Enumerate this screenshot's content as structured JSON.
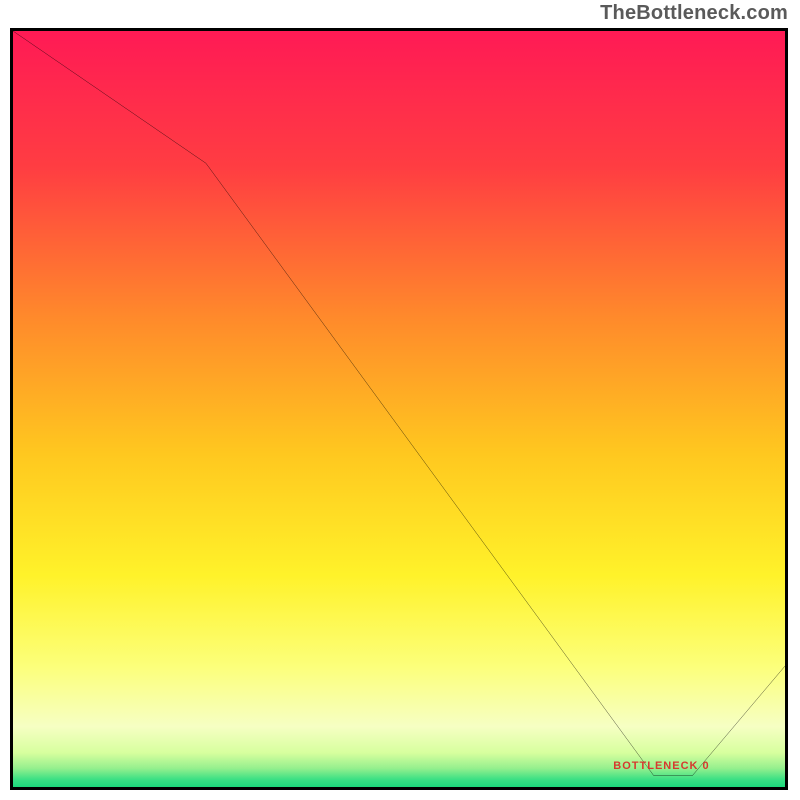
{
  "watermark": "TheBottleneck.com",
  "chart_data": {
    "type": "line",
    "title": "",
    "xlabel": "",
    "ylabel": "",
    "xlim": [
      0,
      100
    ],
    "ylim": [
      0,
      100
    ],
    "x": [
      0,
      25,
      83,
      88,
      100
    ],
    "values": [
      100,
      82.5,
      1.5,
      1.5,
      16
    ],
    "background_gradient": {
      "stops": [
        {
          "pos": 0.0,
          "color": "#ff1a55"
        },
        {
          "pos": 0.18,
          "color": "#ff3d42"
        },
        {
          "pos": 0.38,
          "color": "#ff8a2b"
        },
        {
          "pos": 0.56,
          "color": "#ffc81f"
        },
        {
          "pos": 0.72,
          "color": "#fff22a"
        },
        {
          "pos": 0.84,
          "color": "#fcff7a"
        },
        {
          "pos": 0.92,
          "color": "#f6ffc3"
        },
        {
          "pos": 0.955,
          "color": "#d7ff9e"
        },
        {
          "pos": 0.975,
          "color": "#96f08e"
        },
        {
          "pos": 0.99,
          "color": "#3be084"
        },
        {
          "pos": 1.0,
          "color": "#1bd97c"
        }
      ]
    },
    "minima_label": {
      "text": "BOTTLENECK 0",
      "x": 84
    }
  }
}
